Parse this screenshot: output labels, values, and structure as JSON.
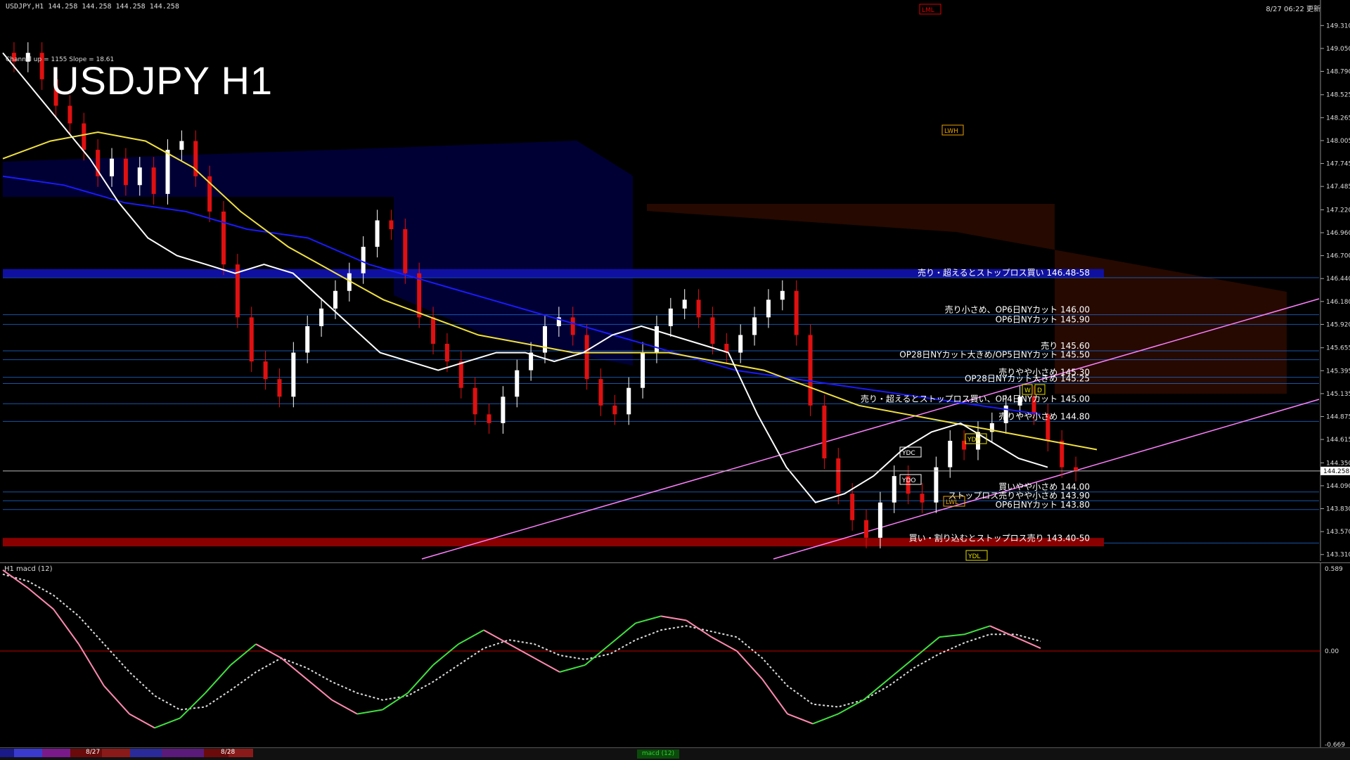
{
  "header": {
    "symbol_info": "USDJPY,H1  144.258 144.258 144.258 144.258",
    "timestamp": "8/27 06:22 更新",
    "title": "USDJPY H1",
    "channel_note": "Channel up = 1155 Slope = 18.61"
  },
  "chart_data": {
    "type": "line",
    "title": "USDJPY H1",
    "price_axis": {
      "ticks": [
        149.31,
        149.05,
        148.79,
        148.525,
        148.265,
        148.005,
        147.745,
        147.485,
        147.22,
        146.96,
        146.7,
        146.44,
        146.18,
        145.92,
        145.655,
        145.395,
        145.135,
        144.875,
        144.615,
        144.35,
        144.09,
        143.83,
        143.57,
        143.31
      ],
      "range": [
        143.26,
        149.44
      ],
      "current_price": "144.258"
    },
    "close_series": [
      148.9,
      149.0,
      148.7,
      148.4,
      148.2,
      147.9,
      147.6,
      147.8,
      147.5,
      147.7,
      147.4,
      147.9,
      148.0,
      147.6,
      147.2,
      146.6,
      146.0,
      145.5,
      145.3,
      145.1,
      145.6,
      145.9,
      146.1,
      146.3,
      146.5,
      146.8,
      147.1,
      147.0,
      146.5,
      146.0,
      145.7,
      145.5,
      145.2,
      144.9,
      144.8,
      145.1,
      145.4,
      145.6,
      145.9,
      146.0,
      145.8,
      145.3,
      145.0,
      144.9,
      145.2,
      145.6,
      145.9,
      146.1,
      146.2,
      146.0,
      145.7,
      145.6,
      145.8,
      146.0,
      146.2,
      146.3,
      145.8,
      145.0,
      144.4,
      144.0,
      143.7,
      143.5,
      143.9,
      144.2,
      144.0,
      143.9,
      144.3,
      144.6,
      144.5,
      144.7,
      144.8,
      145.0,
      145.1,
      144.9,
      144.6,
      144.3,
      144.26
    ],
    "ma_white": [
      149.0,
      148.6,
      148.2,
      147.8,
      147.3,
      146.9,
      146.7,
      146.6,
      146.5,
      146.6,
      146.5,
      146.2,
      145.9,
      145.6,
      145.5,
      145.4,
      145.5,
      145.6,
      145.6,
      145.5,
      145.6,
      145.8,
      145.9,
      145.8,
      145.7,
      145.6,
      144.9,
      144.3,
      143.9,
      144.0,
      144.2,
      144.5,
      144.7,
      144.8,
      144.6,
      144.4,
      144.3
    ],
    "ma_yellow": [
      147.8,
      148.0,
      148.1,
      148.0,
      147.7,
      147.2,
      146.8,
      146.5,
      146.2,
      146.0,
      145.8,
      145.7,
      145.6,
      145.6,
      145.6,
      145.5,
      145.4,
      145.2,
      145.0,
      144.9,
      144.8,
      144.7,
      144.6,
      144.5
    ],
    "ma_blue": [
      147.6,
      147.5,
      147.3,
      147.2,
      147.0,
      146.9,
      146.6,
      146.4,
      146.2,
      146.0,
      145.8,
      145.6,
      145.4,
      145.3,
      145.2,
      145.1,
      145.0,
      144.9
    ],
    "annotations": [
      {
        "text": "売り・超えるとストップロス買い 146.48-58",
        "price": 146.45,
        "color": "#ffffff"
      },
      {
        "text": "売り小さめ、OP6日NYカット 146.00",
        "price": 146.03,
        "color": "#ffffff"
      },
      {
        "text": "OP6日NYカット 145.90",
        "price": 145.92,
        "color": "#ffffff"
      },
      {
        "text": "売り 145.60",
        "price": 145.62,
        "color": "#ffffff"
      },
      {
        "text": "OP28日NYカット大きめ/OP5日NYカット 145.50",
        "price": 145.52,
        "color": "#ffffff"
      },
      {
        "text": "売りやや小さめ 145.30",
        "price": 145.32,
        "color": "#ffffff"
      },
      {
        "text": "OP28日NYカット大きめ 145.25",
        "price": 145.25,
        "color": "#ffffff"
      },
      {
        "text": "売り・超えるとストップロス買い、OP4日NYカット 145.00",
        "price": 145.02,
        "color": "#ffffff"
      },
      {
        "text": "売りやや小さめ 144.80",
        "price": 144.82,
        "color": "#ffffff"
      },
      {
        "text": "買いやや小さめ 144.00",
        "price": 144.02,
        "color": "#ffffff"
      },
      {
        "text": "ストップロス売りやや小さめ 143.90",
        "price": 143.92,
        "color": "#ffffff"
      },
      {
        "text": "OP6日NYカット 143.80",
        "price": 143.82,
        "color": "#ffffff"
      },
      {
        "text": "買い・割り込むとストップロス売り 143.40-50",
        "price": 143.44,
        "color": "#ffffff"
      }
    ],
    "tags": [
      {
        "text": "LWH",
        "color": "#e8a000"
      },
      {
        "text": "LWL",
        "color": "#e8a000"
      },
      {
        "text": "YDH",
        "color": "#e8e000"
      },
      {
        "text": "YDL",
        "color": "#e8e000"
      },
      {
        "text": "YDC",
        "color": "#ffffff"
      },
      {
        "text": "YDO",
        "color": "#ffffff"
      },
      {
        "text": "LML",
        "color": "#e00000"
      },
      {
        "text": "W",
        "color": "#e8e000"
      },
      {
        "text": "D",
        "color": "#e8e000"
      }
    ],
    "macd": {
      "label": "H1  macd (12)",
      "ticks": [
        "0.589",
        "0.00",
        "-0.669"
      ],
      "range": [
        -0.669,
        0.589
      ],
      "main": [
        0.58,
        0.45,
        0.3,
        0.05,
        -0.25,
        -0.45,
        -0.55,
        -0.48,
        -0.3,
        -0.1,
        0.05,
        -0.05,
        -0.2,
        -0.35,
        -0.45,
        -0.42,
        -0.3,
        -0.1,
        0.05,
        0.15,
        0.05,
        -0.05,
        -0.15,
        -0.1,
        0.05,
        0.2,
        0.25,
        0.22,
        0.1,
        0.0,
        -0.2,
        -0.45,
        -0.52,
        -0.45,
        -0.35,
        -0.2,
        -0.05,
        0.1,
        0.12,
        0.18,
        0.1,
        0.02
      ],
      "signal": [
        0.55,
        0.5,
        0.4,
        0.25,
        0.05,
        -0.15,
        -0.32,
        -0.42,
        -0.4,
        -0.28,
        -0.15,
        -0.05,
        -0.12,
        -0.22,
        -0.3,
        -0.35,
        -0.32,
        -0.22,
        -0.1,
        0.02,
        0.08,
        0.05,
        -0.03,
        -0.06,
        -0.02,
        0.08,
        0.15,
        0.18,
        0.14,
        0.1,
        -0.05,
        -0.25,
        -0.38,
        -0.4,
        -0.35,
        -0.25,
        -0.12,
        -0.02,
        0.06,
        0.12,
        0.12,
        0.07
      ]
    }
  },
  "bottom": {
    "date1": "8/27",
    "date2": "8/28",
    "tab_label": "macd (12)"
  },
  "colors": {
    "background": "#000000",
    "ma_white": "#ffffff",
    "ma_yellow": "#f0e040",
    "ma_blue": "#1a1aff",
    "bull_candle": "#ffffff",
    "bear_candle": "#e01010",
    "macd_up": "#40e040",
    "macd_down": "#ff8ab0",
    "channel": "#ff80ff"
  }
}
